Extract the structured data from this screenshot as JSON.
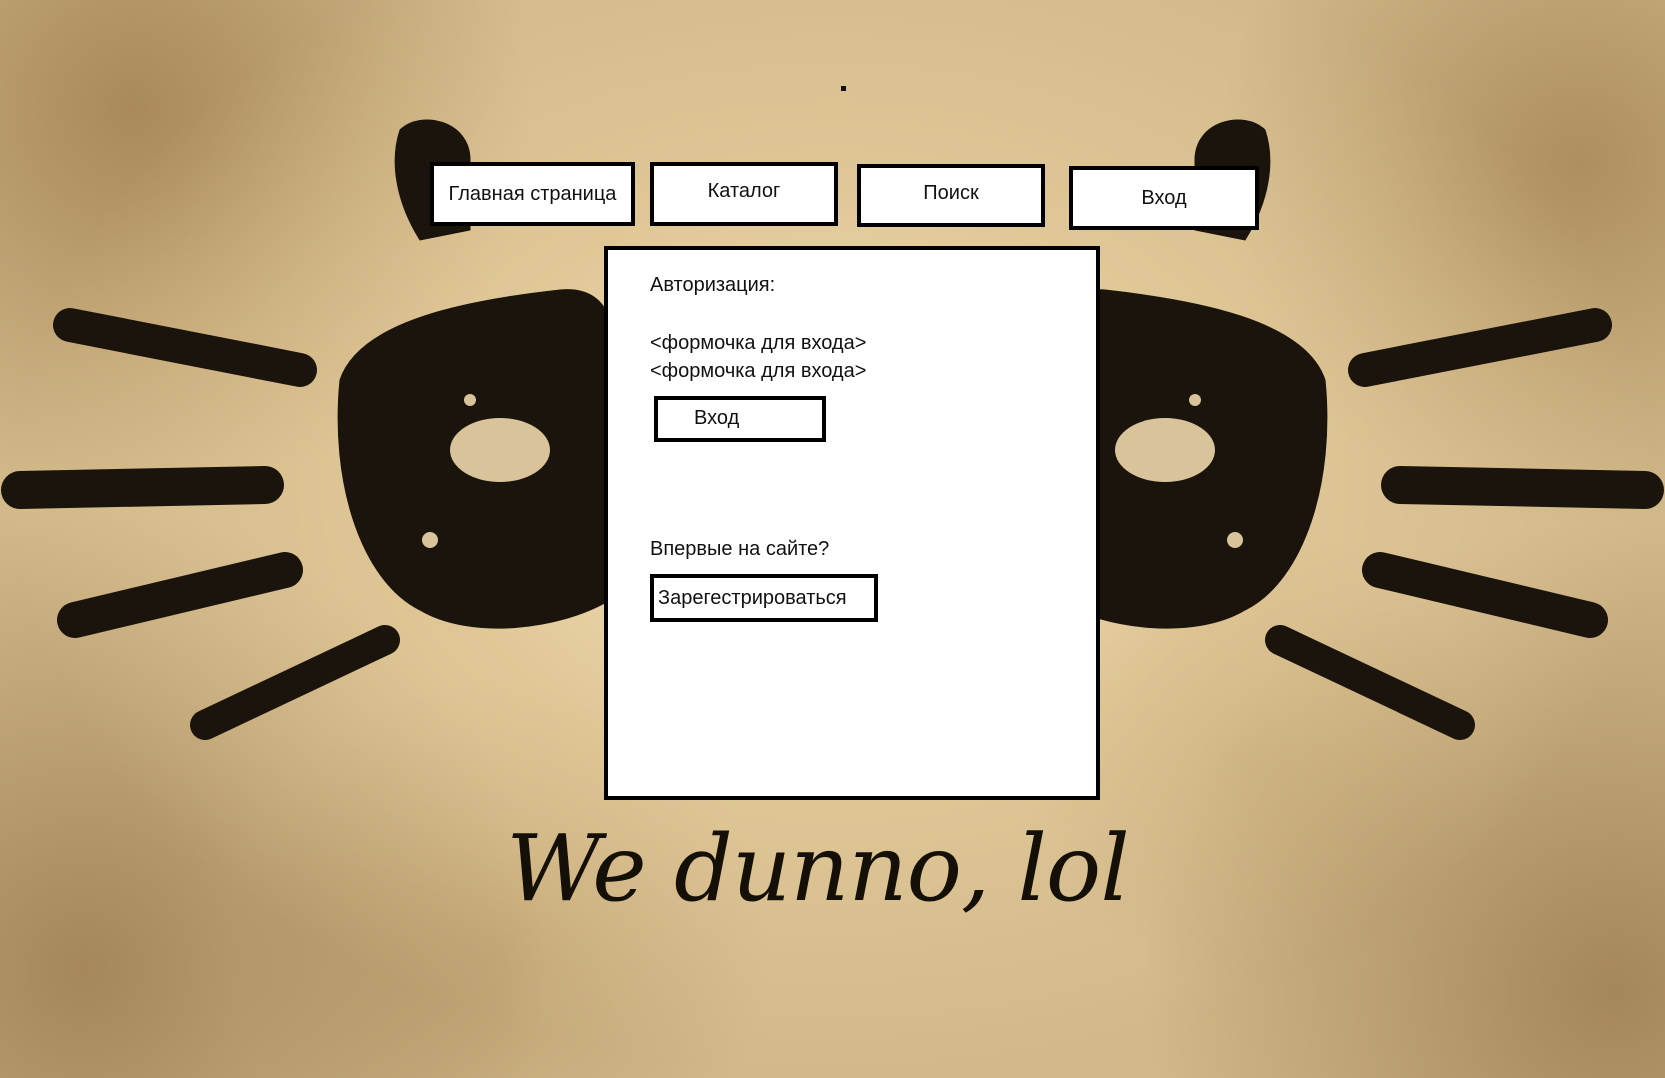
{
  "nav": {
    "items": [
      {
        "label": "Главная страница"
      },
      {
        "label": "Каталог"
      },
      {
        "label": "Поиск"
      },
      {
        "label": "Вход"
      }
    ]
  },
  "auth": {
    "title": "Авторизация:",
    "form_field_1": "<формочка для входа>",
    "form_field_2": "<формочка для входа>",
    "login_button": "Вход",
    "first_time_text": "Впервые на сайте?",
    "register_button": "Зарегестрироваться"
  },
  "slogan": "We dunno, lol",
  "colors": {
    "ink": "#141008",
    "paper": "#d2b98a",
    "panel": "#ffffff",
    "border": "#000000"
  },
  "icons": {
    "background_art": "ink-handprints-illustration"
  }
}
